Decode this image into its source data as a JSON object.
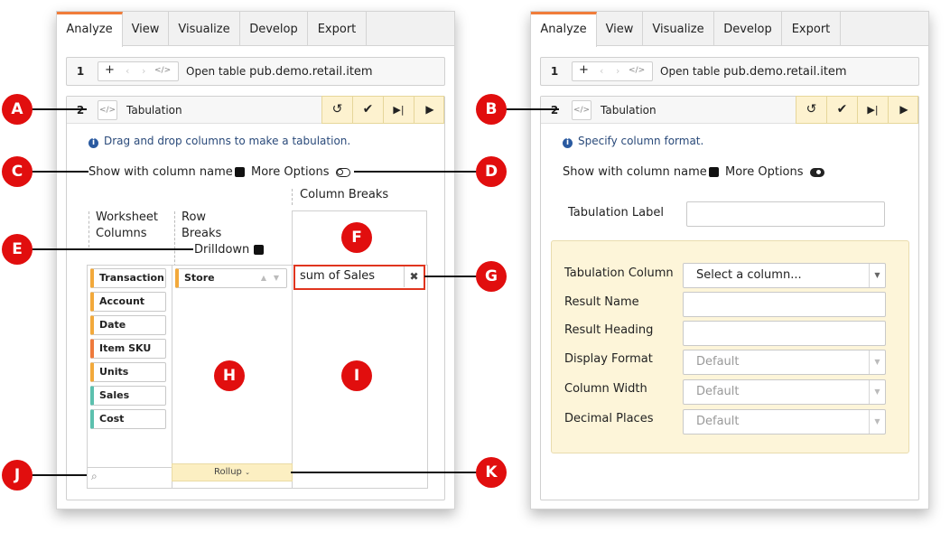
{
  "tabs": [
    "Analyze",
    "View",
    "Visualize",
    "Develop",
    "Export"
  ],
  "step1": {
    "number": "1",
    "plus": "+",
    "code": "</>",
    "prefix": "Open table ",
    "table": "pub.demo.retail.item"
  },
  "step2": {
    "number": "2",
    "code": "</>",
    "title": "Tabulation",
    "actions": [
      "undo-icon",
      "check-icon",
      "step-forward-icon",
      "play-icon"
    ]
  },
  "left": {
    "info": "Drag and drop columns to make a tabulation.",
    "show_column_name": "Show with column name",
    "more_options": "More Options",
    "worksheet_columns_header": [
      "Worksheet",
      "Columns"
    ],
    "row_breaks_header": [
      "Row",
      "Breaks"
    ],
    "column_breaks_header": "Column Breaks",
    "drilldown": "Drilldown",
    "worksheet_columns": [
      {
        "name": "Transaction",
        "color": "#f2a93b"
      },
      {
        "name": "Account",
        "color": "#f2a93b"
      },
      {
        "name": "Date",
        "color": "#f2a93b"
      },
      {
        "name": "Item SKU",
        "color": "#ee7a3c"
      },
      {
        "name": "Units",
        "color": "#f2a93b"
      },
      {
        "name": "Sales",
        "color": "#5cc0ae"
      },
      {
        "name": "Cost",
        "color": "#5cc0ae"
      }
    ],
    "row_break_item": "Store",
    "column_break_item": "sum of Sales",
    "rollup": "Rollup"
  },
  "right": {
    "info": "Specify column format.",
    "show_column_name": "Show with column name",
    "more_options": "More Options",
    "tabulation_label": "Tabulation Label",
    "tabulation_label_value": "",
    "form": [
      {
        "label": "Tabulation Column",
        "value": "Select a column...",
        "type": "select",
        "disabled": false
      },
      {
        "label": "Result Name",
        "value": "",
        "type": "text",
        "disabled": false
      },
      {
        "label": "Result Heading",
        "value": "",
        "type": "text",
        "disabled": false
      },
      {
        "label": "Display Format",
        "value": "Default",
        "type": "select",
        "disabled": true
      },
      {
        "label": "Column Width",
        "value": "Default",
        "type": "select",
        "disabled": true
      },
      {
        "label": "Decimal Places",
        "value": "Default",
        "type": "select",
        "disabled": true
      }
    ]
  },
  "callouts": [
    "A",
    "B",
    "C",
    "D",
    "E",
    "F",
    "G",
    "H",
    "I",
    "J",
    "K"
  ],
  "colors": {
    "accent": "#f07c3a",
    "callout": "#e10e0e",
    "highlight_box": "#e0351f",
    "action_bar": "#fdf2cf",
    "form_panel": "#fdf5d9",
    "info_text": "#2a4a7a"
  }
}
